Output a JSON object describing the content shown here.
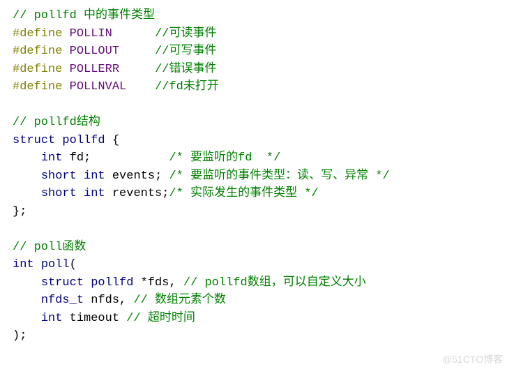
{
  "code": {
    "line1_comment": "// pollfd 中的事件类型",
    "define_keyword": "#define",
    "macros": {
      "pollin": {
        "name": "POLLIN",
        "pad": "      ",
        "comment": "//可读事件"
      },
      "pollout": {
        "name": "POLLOUT",
        "pad": "     ",
        "comment": "//可写事件"
      },
      "pollerr": {
        "name": "POLLERR",
        "pad": "     ",
        "comment": "//错误事件"
      },
      "pollnval": {
        "name": "POLLNVAL",
        "pad": "    ",
        "comment": "//fd未打开"
      }
    },
    "struct_comment": "// pollfd结构",
    "kw_struct": "struct",
    "struct_name": "pollfd",
    "brace_open": " {",
    "kw_int": "int",
    "kw_short": "short",
    "field_fd": "fd",
    "field_fd_comment": "/* 要监听的fd  */",
    "field_events": "events",
    "field_events_comment": "/* 要监听的事件类型：读、写、异常 */",
    "field_revents": "revents",
    "field_revents_comment": "/* 实际发生的事件类型 */",
    "struct_close": "};",
    "poll_func_comment": "// poll函数",
    "poll_name": "poll",
    "poll_param_struct": "struct",
    "poll_param_pollfd": "pollfd",
    "poll_param_fds": " *fds, ",
    "poll_param_fds_comment": "// pollfd数组，可以自定义大小",
    "poll_param_nfds_type": "nfds_t",
    "poll_param_nfds": " nfds, ",
    "poll_param_nfds_comment": "// 数组元素个数",
    "poll_param_timeout_kw": "int",
    "poll_param_timeout": " timeout ",
    "poll_param_timeout_comment": "// 超时时间",
    "poll_close": ");"
  },
  "watermark": "@51CTO博客"
}
